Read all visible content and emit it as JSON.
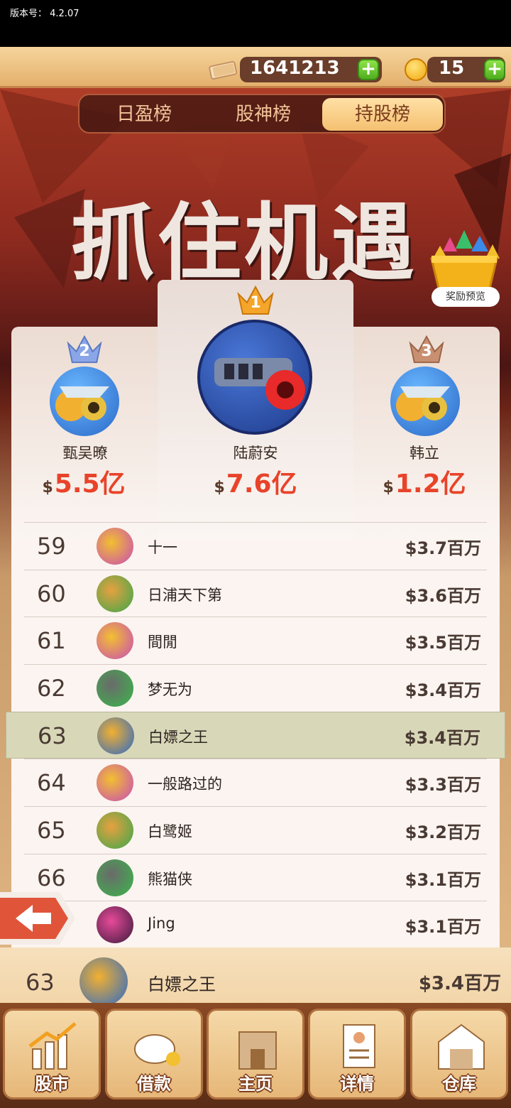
{
  "status": {
    "version": "版本号： 4.2.07"
  },
  "currency": {
    "cash": "1641213",
    "coins": "15",
    "plus": "+"
  },
  "tabs": [
    {
      "label": "日盈榜"
    },
    {
      "label": "股神榜"
    },
    {
      "label": "持股榜"
    }
  ],
  "banner": {
    "title": "抓住机遇"
  },
  "reward": {
    "label": "奖励预览"
  },
  "top3": [
    {
      "rank": "1",
      "name": "陆蔚安",
      "dollar": "$",
      "amount": "7.6亿"
    },
    {
      "rank": "2",
      "name": "甄吴暸",
      "dollar": "$",
      "amount": "5.5亿"
    },
    {
      "rank": "3",
      "name": "韩立",
      "dollar": "$",
      "amount": "1.2亿"
    }
  ],
  "rows": [
    {
      "rank": "59",
      "name": "十一",
      "value": "$3.7百万"
    },
    {
      "rank": "60",
      "name": "日浦天下第",
      "value": "$3.6百万"
    },
    {
      "rank": "61",
      "name": "間閒",
      "value": "$3.5百万"
    },
    {
      "rank": "62",
      "name": "梦无为",
      "value": "$3.4百万"
    },
    {
      "rank": "63",
      "name": "白嫖之王",
      "value": "$3.4百万"
    },
    {
      "rank": "64",
      "name": "一般路过的",
      "value": "$3.3百万"
    },
    {
      "rank": "65",
      "name": "白鹭姬",
      "value": "$3.2百万"
    },
    {
      "rank": "66",
      "name": "熊猫侠",
      "value": "$3.1百万"
    },
    {
      "rank": "",
      "name": "Jing",
      "value": "$3.1百万"
    }
  ],
  "me": {
    "rank": "63",
    "name": "白嫖之王",
    "value": "$3.4百万"
  },
  "nav": [
    {
      "label": "股市"
    },
    {
      "label": "借款"
    },
    {
      "label": "主页"
    },
    {
      "label": "详情"
    },
    {
      "label": "仓库"
    }
  ],
  "colors": {
    "accent": "#e8432a",
    "highlight_row": "#d8d8b8",
    "active_tab": "#f4c070"
  }
}
